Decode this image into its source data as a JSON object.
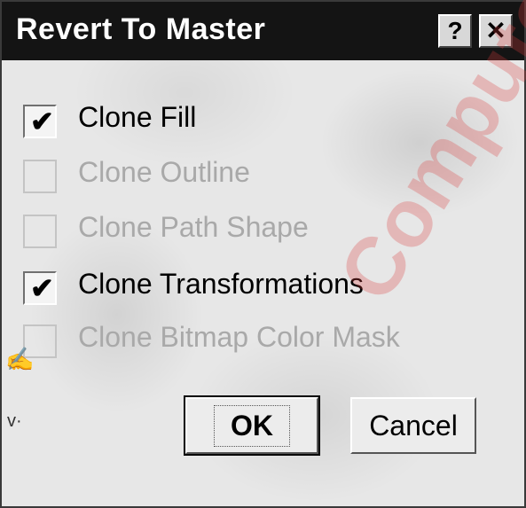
{
  "dialog": {
    "title": "Revert To Master",
    "help_label": "?",
    "close_label": "✕"
  },
  "options": [
    {
      "label": "Clone Fill",
      "checked": true,
      "enabled": true
    },
    {
      "label": "Clone Outline",
      "checked": false,
      "enabled": false
    },
    {
      "label": "Clone Path Shape",
      "checked": false,
      "enabled": false
    },
    {
      "label": "Clone Transformations",
      "checked": true,
      "enabled": true
    },
    {
      "label": "Clone Bitmap Color Mask",
      "checked": false,
      "enabled": false
    }
  ],
  "buttons": {
    "ok_label": "OK",
    "cancel_label": "Cancel"
  },
  "check_glyph": "✔",
  "watermark_text": "Compute"
}
